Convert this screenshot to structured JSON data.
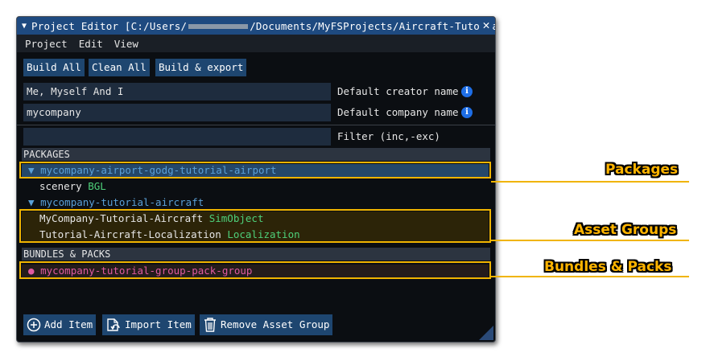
{
  "window": {
    "title_prefix": "Project Editor [C:/Users/",
    "title_suffix": "/Documents/MyFSProjects/Aircraft-Tutorial]"
  },
  "menu": [
    "Project",
    "Edit",
    "View"
  ],
  "toolbar": {
    "build_all": "Build All",
    "clean_all": "Clean All",
    "build_export": "Build & export"
  },
  "fields": {
    "creator": {
      "value": "Me, Myself And I",
      "label": "Default creator name"
    },
    "company": {
      "value": "mycompany",
      "label": "Default company name"
    },
    "filter": {
      "value": "",
      "label": "Filter (inc,-exc)"
    }
  },
  "packages": {
    "header": "PACKAGES",
    "items": [
      {
        "name": "mycompany-airport-godg-tutorial-airport",
        "asset": "scenery",
        "asset_type": "BGL"
      },
      {
        "name": "mycompany-tutorial-aircraft",
        "assets": [
          {
            "name": "MyCompany-Tutorial-Aircraft",
            "type": "SimObject"
          },
          {
            "name": "Tutorial-Aircraft-Localization",
            "type": "Localization"
          }
        ]
      }
    ]
  },
  "bundles": {
    "header": "BUNDLES & PACKS",
    "items": [
      "mycompany-tutorial-group-pack-group"
    ]
  },
  "bottom_buttons": {
    "add_item": "Add Item",
    "import_item": "Import Item",
    "remove_group": "Remove Asset Group"
  },
  "callouts": {
    "packages": "Packages",
    "asset_groups": "Asset Groups",
    "bundles": "Bundles & Packs"
  },
  "colors": {
    "accent": "#1e4a80",
    "highlight": "#f0b400",
    "package": "#5aa0d8",
    "asset_type": "#4ed07a",
    "bundle": "#e05aa0"
  }
}
